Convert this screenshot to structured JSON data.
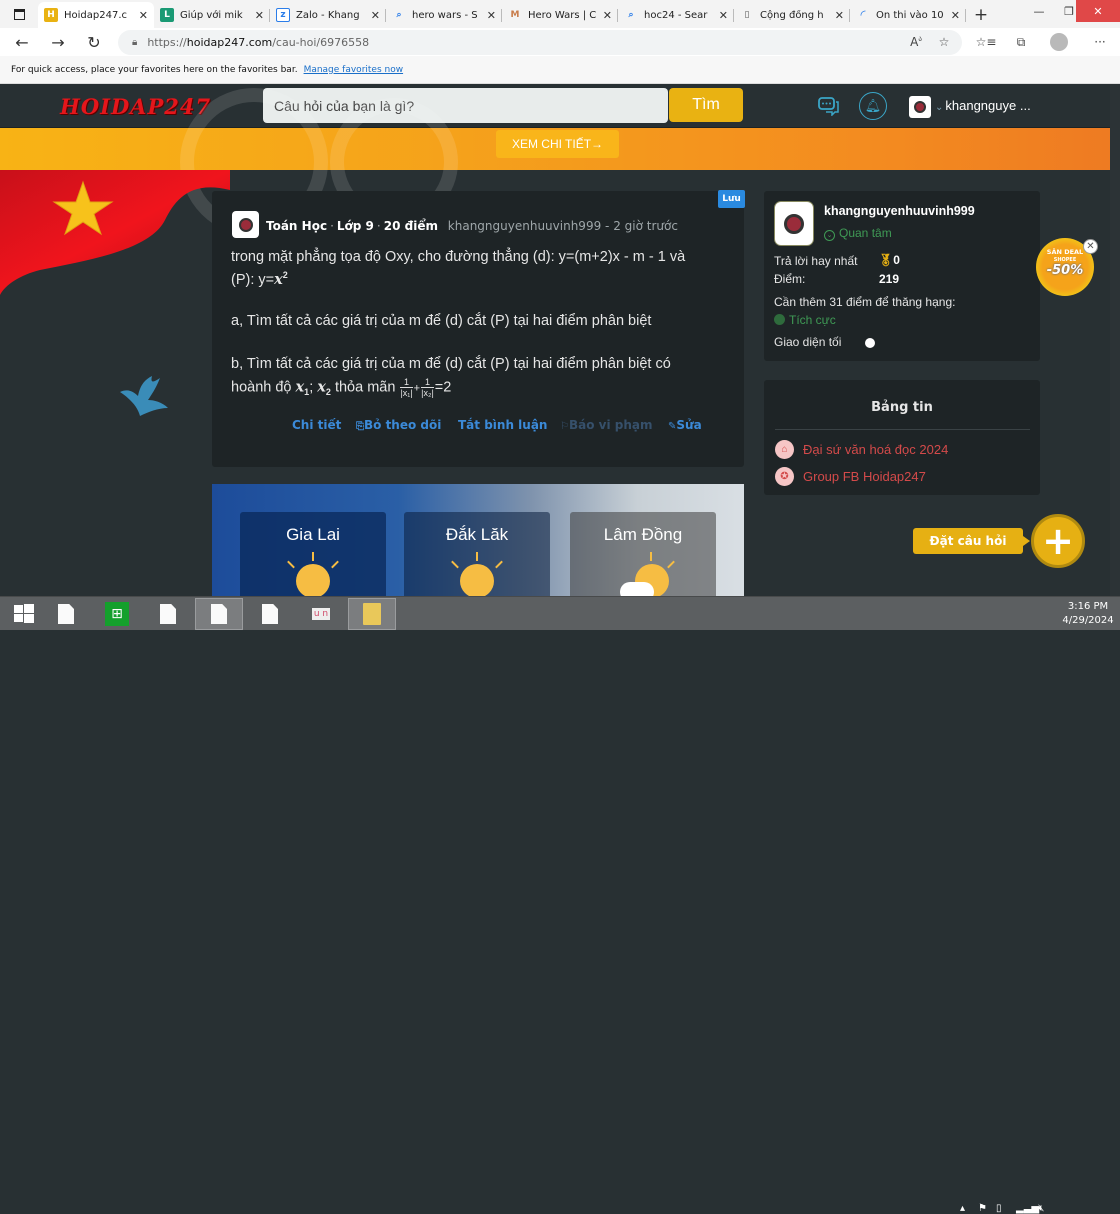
{
  "browser": {
    "tabs": [
      {
        "title": "Hoidap247.c",
        "icon": "hoidap247-favicon",
        "icon_color": "#e9b212",
        "icon_text": "H",
        "active": true
      },
      {
        "title": "Giúp với mik",
        "icon": "letter-l-favicon",
        "icon_color": "#1a9a74",
        "icon_text": "L",
        "active": false
      },
      {
        "title": "Zalo - Khang",
        "icon": "zalo-favicon",
        "icon_color": "#2b7de9",
        "icon_text": "z",
        "active": false
      },
      {
        "title": "hero wars - S",
        "icon": "search-icon",
        "icon_color": "#2b7de9",
        "icon_text": "⌕",
        "active": false
      },
      {
        "title": "Hero Wars | C",
        "icon": "hero-wars-favicon",
        "icon_color": "#c87c4a",
        "icon_text": "M",
        "active": false
      },
      {
        "title": "hoc24 - Sear",
        "icon": "search-icon",
        "icon_color": "#2b7de9",
        "icon_text": "⌕",
        "active": false
      },
      {
        "title": "Cộng đồng h",
        "icon": "page-icon",
        "icon_color": "#555555",
        "icon_text": "▯",
        "active": false
      },
      {
        "title": "Ôn thi vào 10",
        "icon": "loading-icon",
        "icon_color": "#2b7de9",
        "icon_text": "◜",
        "active": false
      }
    ],
    "url_scheme": "https://",
    "url_host": "hoidap247.com",
    "url_path": "/cau-hoi/6976558",
    "favorites_hint": "For quick access, place your favorites here on the favorites bar.",
    "favorites_link": "Manage favorites now"
  },
  "site": {
    "logo": "HOIDAP247",
    "search_placeholder": "Câu hỏi của bạn là gì?",
    "search_button": "Tìm",
    "username_short": "khangnguye ...",
    "banner_button": "XEM CHI TIẾT→",
    "brand_color": "#e9b212"
  },
  "question": {
    "save_badge": "Lưu",
    "subject": "Toán Học",
    "grade": "Lớp 9",
    "points": "20 điểm",
    "author": "khangnguyenhuuvinh999",
    "time": "2 giờ trước",
    "line1": "trong mặt phẳng tọa độ Oxy, cho đường thẳng (d): y=(m+2)x - m - 1 và",
    "line2_prefix": "(P): y=",
    "line2_math": "x",
    "line2_sup": "2",
    "part_a": "a, Tìm tất cả các giá trị của m để (d) cắt (P) tại hai điểm phân biệt",
    "part_b1": "b, Tìm tất cả các giá trị của m để (d) cắt (P) tại hai điểm phân biệt có",
    "part_b2_prefix": "hoành độ",
    "x1": "x",
    "x1_sub": "1",
    "sep": ";",
    "x2": "x",
    "x2_sub": "2",
    "part_b2_mid": "thỏa mãn",
    "frac1_num": "1",
    "frac1_den": "|x₁|",
    "plus": "+",
    "frac2_num": "1",
    "frac2_den": "|x₂|",
    "part_b2_end": "=2",
    "actions": {
      "detail": "Chi tiết",
      "unfollow": "Bỏ theo dõi",
      "disable_comments": "Tắt bình luận",
      "report": "Báo vi phạm",
      "edit": "Sửa"
    }
  },
  "weather": {
    "cards": [
      {
        "name": "Gia Lai",
        "condition": "sunny"
      },
      {
        "name": "Đắk Lăk",
        "condition": "sunny"
      },
      {
        "name": "Lâm Đồng",
        "condition": "partly-cloudy"
      }
    ]
  },
  "profile": {
    "username": "khangnguyenhuuvinh999",
    "follow": "Quan tâm",
    "best_answers_label": "Trả lời hay nhất",
    "best_answers_value": "0",
    "points_label": "Điểm:",
    "points_value": "219",
    "rank_hint": "Cần thêm 31 điểm để thăng hạng:",
    "rank_name": "Tích cực",
    "dark_mode_label": "Giao diện tối",
    "dark_mode_on": true
  },
  "news": {
    "title": "Bảng tin",
    "items": [
      {
        "label": "Đại sứ văn hoá đọc 2024",
        "icon": "building-icon"
      },
      {
        "label": "Group FB Hoidap247",
        "icon": "bulb-icon"
      }
    ]
  },
  "promo": {
    "line1": "SĂN DEAL",
    "line2": "SHOPEE",
    "line3": "-50%"
  },
  "ask_button": "Đặt câu hỏi",
  "taskbar": {
    "time": "3:16 PM",
    "date": "4/29/2024"
  }
}
